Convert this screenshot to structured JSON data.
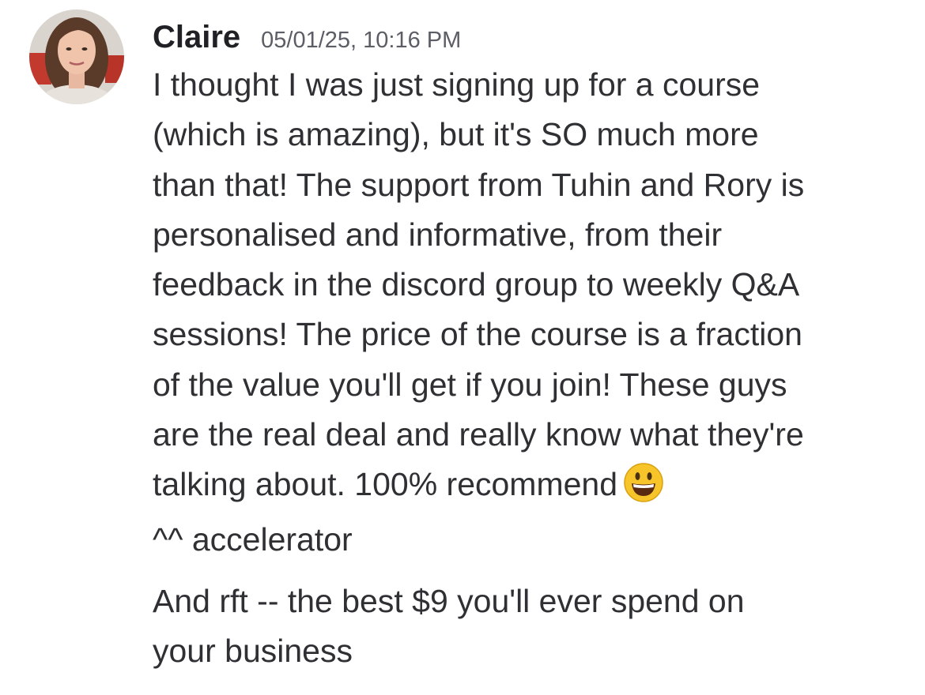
{
  "message": {
    "author": "Claire",
    "timestamp": "05/01/25, 10:16 PM",
    "avatar_icon": "user-avatar-photo",
    "body_lines": [
      "I thought I was just signing up for a course",
      "(which is amazing), but it's SO much more",
      "than that!  The support from Tuhin and Rory is",
      "personalised and informative, from their",
      "feedback in the discord group to weekly Q&A",
      "sessions! The price of the course is a fraction",
      "of the value you'll get if you join! These guys",
      "are the real deal and really know what they're",
      "talking about. 100% recommend"
    ],
    "emoji": "grinning-face-with-big-eyes",
    "followup_1": "^^ accelerator",
    "followup_2_lines": [
      "And rft -- the best $9 you'll ever spend on",
      "your business"
    ]
  },
  "colors": {
    "text": "#2e3033",
    "username": "#1f2124",
    "timestamp": "#5c5e66",
    "background": "#ffffff",
    "emoji_face": "#f7c52a"
  }
}
